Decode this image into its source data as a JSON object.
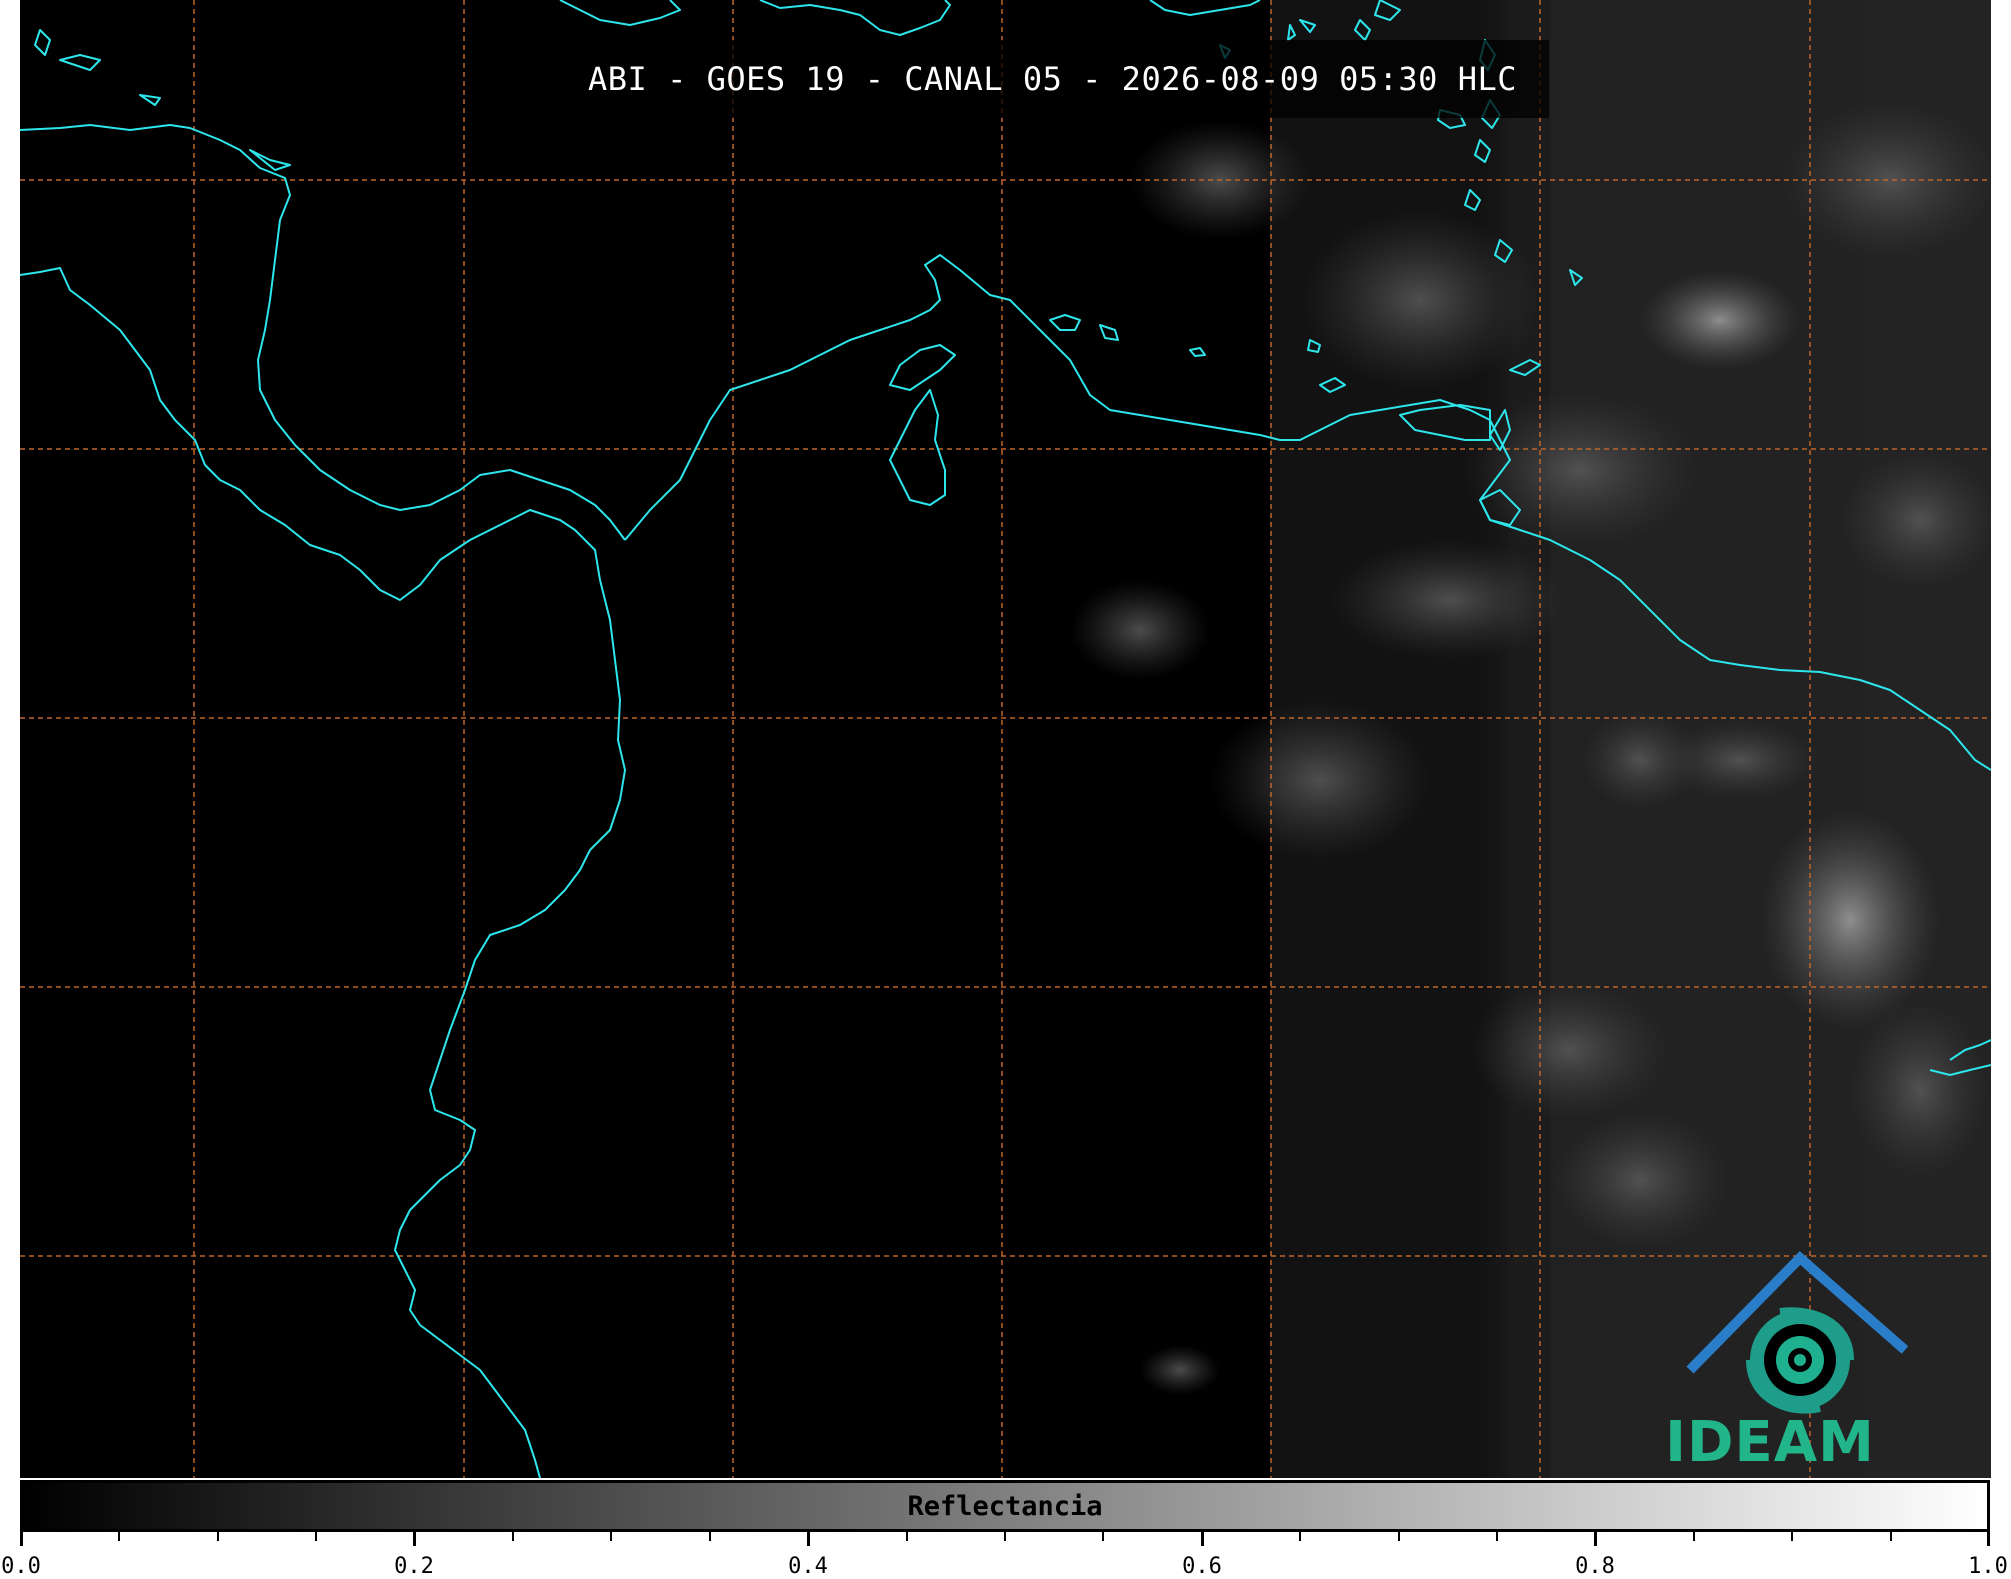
{
  "title": "ABI - GOES 19 - CANAL 05 - 2026-08-09 05:30 HLC",
  "logo": {
    "text": "IDEAM",
    "icon": "ideam-logo-icon"
  },
  "colorbar": {
    "label": "Reflectancia",
    "min": 0.0,
    "max": 1.0,
    "tick_labels": [
      "0.0",
      "0.2",
      "0.4",
      "0.6",
      "0.8",
      "1.0"
    ],
    "gradient_start": "#000000",
    "gradient_end": "#ffffff"
  },
  "colors": {
    "coastline": "#2de6ec",
    "gridline": "#c0642a",
    "background": "#000000"
  }
}
